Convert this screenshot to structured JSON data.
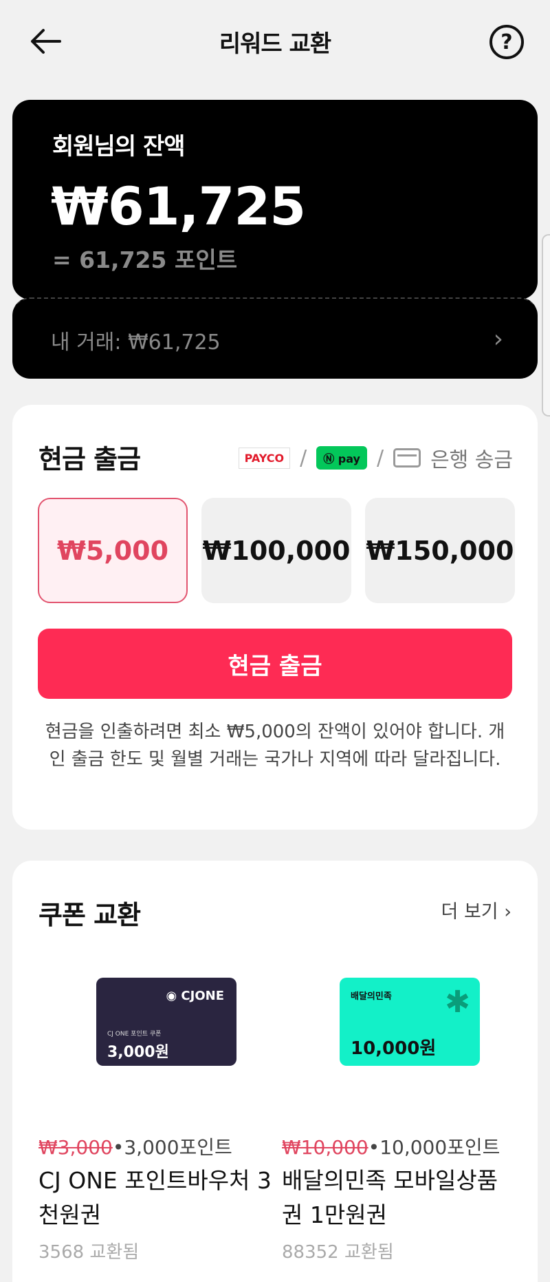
{
  "header": {
    "title": "리워드 교환",
    "help_label": "?"
  },
  "balance": {
    "label": "회원님의 잔액",
    "amount": "₩61,725",
    "points": "= 61,725 포인트"
  },
  "transactions": {
    "label": "내 거래: ₩61,725",
    "chevron": "›"
  },
  "cash_withdraw": {
    "title": "현금 출금",
    "methods": {
      "payco": "PAYCO",
      "npay": "pay",
      "separator": "/",
      "bank": "은행 송금"
    },
    "amounts": [
      "₩5,000",
      "₩100,000",
      "₩150,000"
    ],
    "selected_index": 0,
    "button_label": "현금 출금",
    "notice": "현금을 인출하려면 최소 ₩5,000의 잔액이 있어야 합니다. 개인 출금 한도 및 월별 거래는 국가나 지역에 따라 달라집니다."
  },
  "coupons": {
    "title": "쿠폰 교환",
    "more_label": "더 보기 ›",
    "items": [
      {
        "image_brand": "CJONE",
        "image_sub": "CJ ONE 포인트 쿠폰",
        "image_amount": "3,000원",
        "original_price": "₩3,000",
        "points": "•3,000포인트",
        "name": "CJ ONE 포인트바우처 3천원권",
        "count": "3568 교환됨"
      },
      {
        "image_brand": "배달의민족",
        "image_amount": "10,000원",
        "original_price": "₩10,000",
        "points": "•10,000포인트",
        "name": "배달의민족 모바일상품권 1만원권",
        "count": "88352 교환됨"
      }
    ]
  },
  "colors": {
    "accent": "#fe2b54",
    "selected_text": "#e0455f",
    "card_dark": "#000000"
  }
}
